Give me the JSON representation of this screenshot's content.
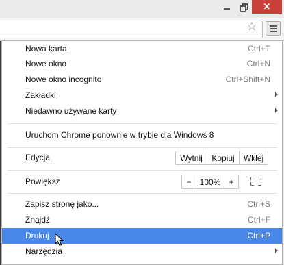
{
  "window": {
    "close_glyph": "✕"
  },
  "toolbar": {
    "star_icon": "star-icon",
    "menu_icon": "hamburger-menu-icon"
  },
  "menu": {
    "new_tab": {
      "label": "Nowa karta",
      "shortcut": "Ctrl+T"
    },
    "new_window": {
      "label": "Nowe okno",
      "shortcut": "Ctrl+N"
    },
    "new_incognito": {
      "label": "Nowe okno incognito",
      "shortcut": "Ctrl+Shift+N"
    },
    "bookmarks": {
      "label": "Zakładki"
    },
    "recent_tabs": {
      "label": "Niedawno używane karty"
    },
    "relaunch": {
      "label": "Uruchom Chrome ponownie w trybie dla Windows 8"
    },
    "edit": {
      "label": "Edycja",
      "cut": "Wytnij",
      "copy": "Kopiuj",
      "paste": "Wklej"
    },
    "zoom": {
      "label": "Powiększ",
      "minus": "−",
      "value": "100%",
      "plus": "+"
    },
    "save_page": {
      "label": "Zapisz stronę jako...",
      "shortcut": "Ctrl+S"
    },
    "find": {
      "label": "Znajdź",
      "shortcut": "Ctrl+F"
    },
    "print": {
      "label": "Drukuj...",
      "shortcut": "Ctrl+P"
    },
    "tools": {
      "label": "Narzędzia"
    }
  },
  "colors": {
    "highlight": "#4a88e8",
    "close_button": "#c7403a"
  }
}
